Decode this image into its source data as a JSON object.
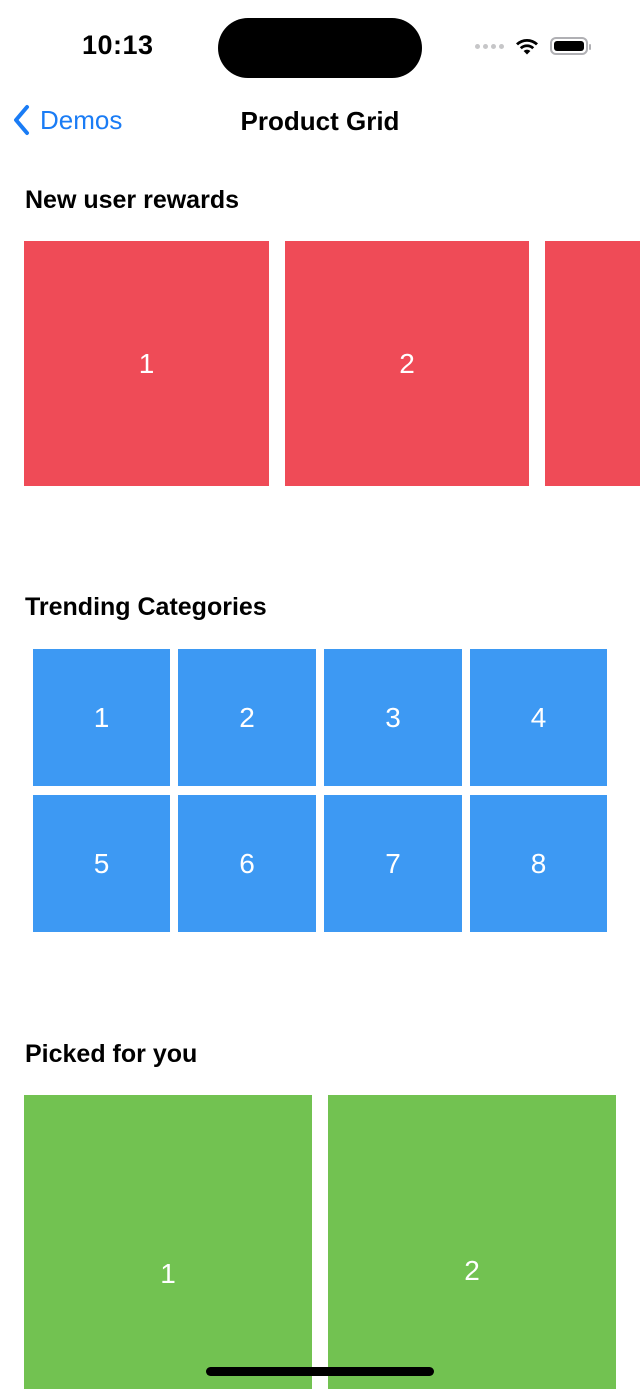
{
  "status_bar": {
    "time": "10:13"
  },
  "nav": {
    "back_label": "Demos",
    "title": "Product Grid"
  },
  "sections": {
    "rewards": {
      "title": "New user rewards",
      "items": [
        "1",
        "2"
      ]
    },
    "trending": {
      "title": "Trending Categories",
      "items": [
        "1",
        "2",
        "3",
        "4",
        "5",
        "6",
        "7",
        "8"
      ]
    },
    "picked": {
      "title": "Picked for you",
      "items": [
        "1",
        "2"
      ]
    }
  },
  "colors": {
    "accent": "#1a7cf5",
    "rewards_tile": "#ef4b57",
    "trending_tile": "#3d99f3",
    "picked_tile": "#72c251"
  },
  "icons": {
    "back": "chevron-left-icon",
    "signal": "cellular-signal-icon",
    "wifi": "wifi-icon",
    "battery": "battery-icon"
  }
}
